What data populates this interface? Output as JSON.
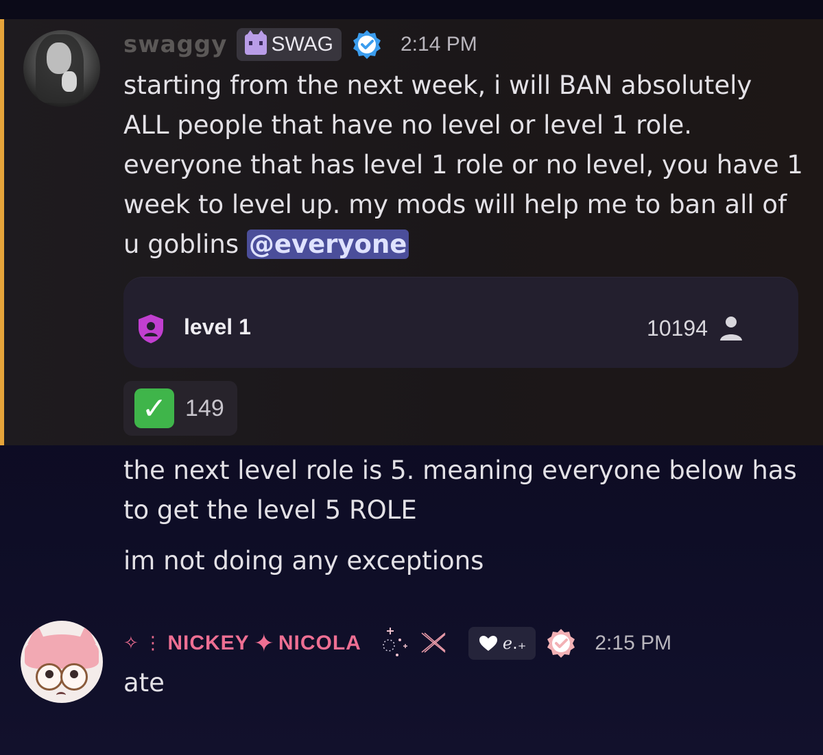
{
  "message1": {
    "author": "swaggy",
    "server_tag": "SWAG",
    "timestamp": "2:14 PM",
    "text_lines": [
      "starting from the next week, i will BAN absolutely",
      "ALL people that have no level or level 1 role.",
      "everyone that has level 1 role or no level, you have 1",
      "week to level up. my mods will help me to ban all of"
    ],
    "last_line_prefix": "u goblins ",
    "mention": "@everyone",
    "role_card": {
      "role_name": "level 1",
      "member_count": "10194"
    },
    "reaction": {
      "emoji": "✓",
      "count": "149"
    }
  },
  "followups": [
    "the next level role is 5. meaning everyone below has",
    "to get the level 5 ROLE",
    "im not doing any exceptions"
  ],
  "message2": {
    "name_part1": "NICKEY",
    "name_part2": "NICOLA",
    "name_prefix": "✧ ⋮ ",
    "tag_text": "ℯ.₊",
    "timestamp": "2:15 PM",
    "text": "ate"
  },
  "colors": {
    "highlight_bar": "#e6a43a",
    "mention_bg": "#4b4e9a",
    "name2": "#ee6f93",
    "reaction_green": "#3fb54a",
    "verified_blue": "#3b9dee",
    "verified_pink": "#f2b1b5"
  }
}
